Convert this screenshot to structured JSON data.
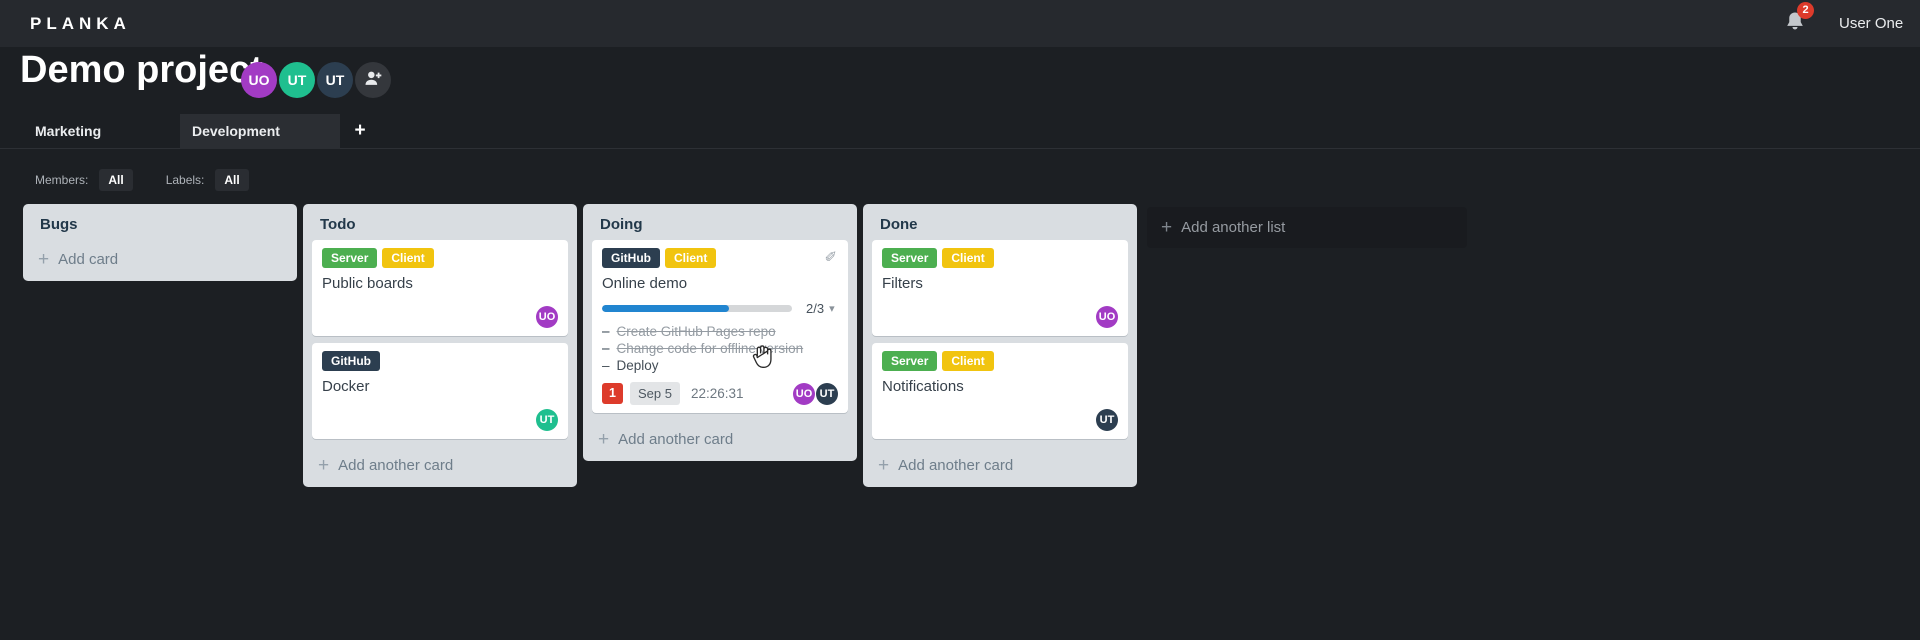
{
  "header": {
    "logo": "PLANKA",
    "notification_count": "2",
    "user_name": "User One"
  },
  "project": {
    "title": "Demo project",
    "members": [
      {
        "initials": "UO",
        "color": "#a23bc4"
      },
      {
        "initials": "UT",
        "color": "#1fbf8f"
      },
      {
        "initials": "UT",
        "color": "#2c3e50"
      }
    ]
  },
  "tabs": {
    "items": [
      {
        "label": "Marketing"
      },
      {
        "label": "Development"
      }
    ],
    "active": "Development"
  },
  "filters": {
    "members_label": "Members:",
    "members_value": "All",
    "labels_label": "Labels:",
    "labels_value": "All"
  },
  "board": {
    "add_list_label": "Add another list",
    "lists": [
      {
        "name": "Bugs",
        "footer_label": "Add card",
        "cards": []
      },
      {
        "name": "Todo",
        "footer_label": "Add another card",
        "cards": [
          {
            "title": "Public boards",
            "labels": [
              {
                "text": "Server",
                "color": "#4caf50"
              },
              {
                "text": "Client",
                "color": "#f1c40f"
              }
            ],
            "members": [
              {
                "initials": "UO",
                "color": "#a23bc4"
              }
            ]
          },
          {
            "title": "Docker",
            "labels": [
              {
                "text": "GitHub",
                "color": "#2c3e50"
              }
            ],
            "members": [
              {
                "initials": "UT",
                "color": "#1fbf8f"
              }
            ]
          }
        ]
      },
      {
        "name": "Doing",
        "footer_label": "Add another card",
        "cards": [
          {
            "title": "Online demo",
            "labels": [
              {
                "text": "GitHub",
                "color": "#2c3e50"
              },
              {
                "text": "Client",
                "color": "#f1c40f"
              }
            ],
            "progress": {
              "percent": 67,
              "label": "2/3",
              "bar_color": "#2185d0"
            },
            "tasks": [
              {
                "text": "Create GitHub Pages repo",
                "completed": true
              },
              {
                "text": "Change code for offline version",
                "completed": true
              },
              {
                "text": "Deploy",
                "completed": false
              }
            ],
            "notification_count": "1",
            "due_date": "Sep 5",
            "timer": "22:26:31",
            "members": [
              {
                "initials": "UO",
                "color": "#a23bc4"
              },
              {
                "initials": "UT",
                "color": "#2c3e50"
              }
            ]
          }
        ]
      },
      {
        "name": "Done",
        "footer_label": "Add another card",
        "cards": [
          {
            "title": "Filters",
            "labels": [
              {
                "text": "Server",
                "color": "#4caf50"
              },
              {
                "text": "Client",
                "color": "#f1c40f"
              }
            ],
            "members": [
              {
                "initials": "UO",
                "color": "#a23bc4"
              }
            ]
          },
          {
            "title": "Notifications",
            "labels": [
              {
                "text": "Server",
                "color": "#4caf50"
              },
              {
                "text": "Client",
                "color": "#f1c40f"
              }
            ],
            "members": [
              {
                "initials": "UT",
                "color": "#2c3e50"
              }
            ]
          }
        ]
      }
    ]
  },
  "glyphs": {
    "plus": "+",
    "dash": "–",
    "chevron_down": "▾",
    "pencil": "✎"
  },
  "colors": {
    "badge_red": "#dd3b2b",
    "accent_blue": "#2185d0",
    "topbar_bg": "#26292e",
    "board_bg": "#1c1f23",
    "list_bg": "#d9dde1"
  }
}
